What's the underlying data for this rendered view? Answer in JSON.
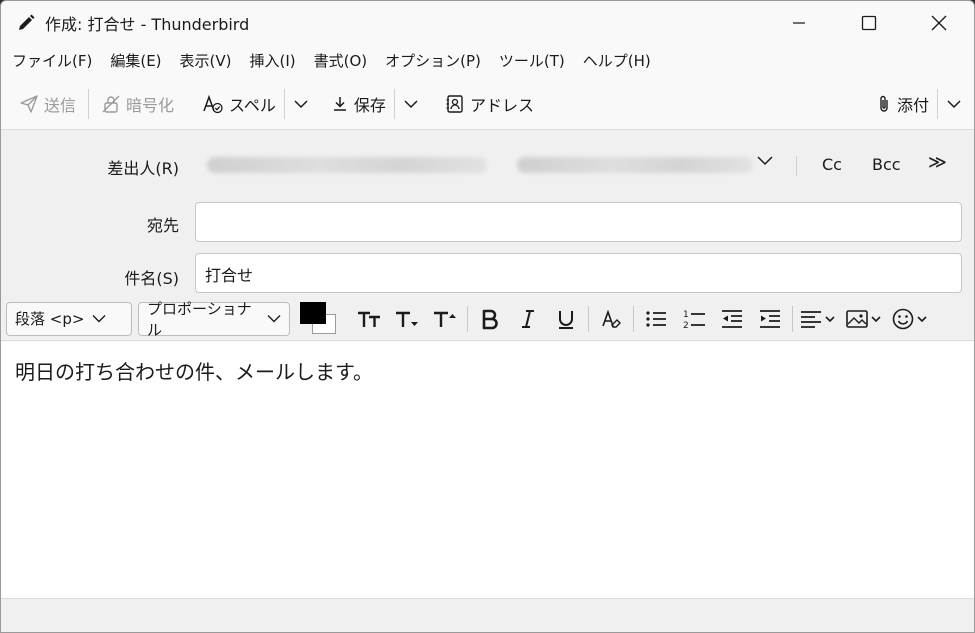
{
  "window": {
    "title": "作成: 打合せ - Thunderbird"
  },
  "menubar": [
    "ファイル(F)",
    "編集(E)",
    "表示(V)",
    "挿入(I)",
    "書式(O)",
    "オプション(P)",
    "ツール(T)",
    "ヘルプ(H)"
  ],
  "toolbar": {
    "send_label": "送信",
    "encrypt_label": "暗号化",
    "spell_label": "スペル",
    "save_label": "保存",
    "address_label": "アドレス",
    "attach_label": "添付"
  },
  "headers": {
    "from_label": "差出人(R)",
    "to_label": "宛先",
    "subject_label": "件名(S)",
    "subject_value": "打合せ",
    "to_value": "",
    "cc_label": "Cc",
    "bcc_label": "Bcc",
    "more_label": "≫"
  },
  "format": {
    "paragraph_select": "段落 <p>",
    "font_select": "プロポーショナル",
    "text_color": "#000000",
    "bg_color": "#ffffff"
  },
  "body": {
    "text": "明日の打ち合わせの件、メールします。"
  }
}
